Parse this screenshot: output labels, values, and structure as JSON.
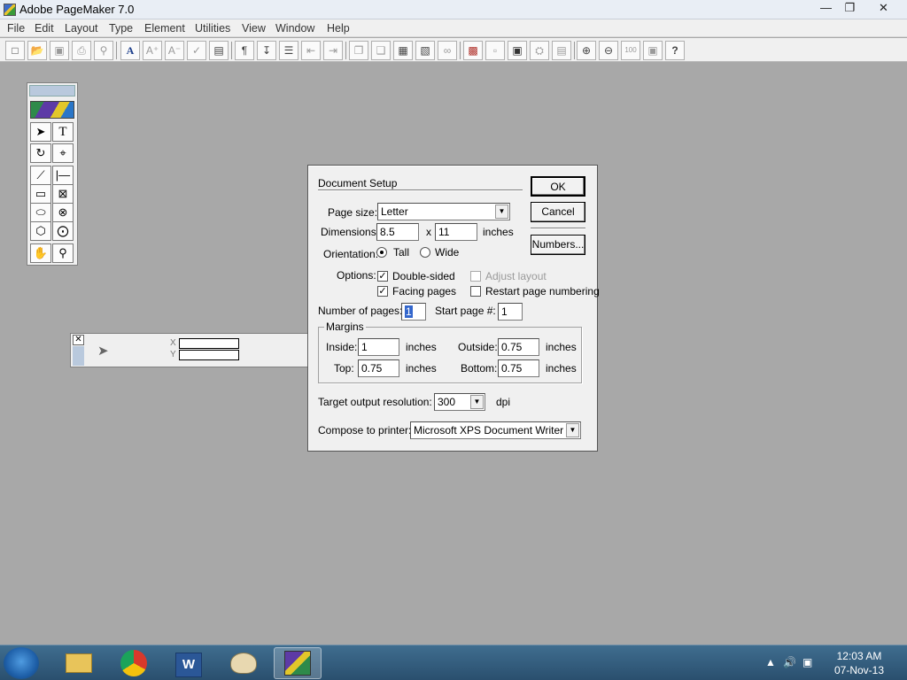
{
  "window": {
    "title": "Adobe PageMaker 7.0"
  },
  "menu": [
    "File",
    "Edit",
    "Layout",
    "Type",
    "Element",
    "Utilities",
    "View",
    "Window",
    "Help"
  ],
  "toolbox": {
    "tools": [
      "pointer-tool",
      "text-tool",
      "rotate-tool",
      "crop-tool",
      "line-tool",
      "constrained-line-tool",
      "rectangle-tool",
      "rectangle-frame-tool",
      "ellipse-tool",
      "ellipse-frame-tool",
      "polygon-tool",
      "polygon-frame-tool",
      "hand-tool",
      "zoom-tool"
    ]
  },
  "control_palette": {
    "x_label": "X",
    "y_label": "Y"
  },
  "dialog": {
    "title": "Document Setup",
    "ok_label": "OK",
    "cancel_label": "Cancel",
    "numbers_label": "Numbers...",
    "page_size_label": "Page size:",
    "page_size_value": "Letter",
    "dimensions_label": "Dimensions:",
    "width_value": "8.5",
    "x_label": "x",
    "height_value": "11",
    "dimensions_unit": "inches",
    "orientation_label": "Orientation:",
    "tall_label": "Tall",
    "wide_label": "Wide",
    "options_label": "Options:",
    "double_sided_label": "Double-sided",
    "adjust_layout_label": "Adjust layout",
    "facing_pages_label": "Facing pages",
    "restart_numbering_label": "Restart page numbering",
    "num_pages_label": "Number of pages:",
    "num_pages_value": "1",
    "start_page_label": "Start page #:",
    "start_page_value": "1",
    "margins_label": "Margins",
    "inside_label": "Inside:",
    "inside_value": "1",
    "outside_label": "Outside:",
    "outside_value": "0.75",
    "top_label": "Top:",
    "top_value": "0.75",
    "bottom_label": "Bottom:",
    "bottom_value": "0.75",
    "inches": "inches",
    "resolution_label": "Target output resolution:",
    "resolution_value": "300",
    "dpi_label": "dpi",
    "printer_label": "Compose to printer:",
    "printer_value": "Microsoft XPS Document Writer on X"
  },
  "taskbar": {
    "time": "12:03 AM",
    "date": "07-Nov-13"
  }
}
